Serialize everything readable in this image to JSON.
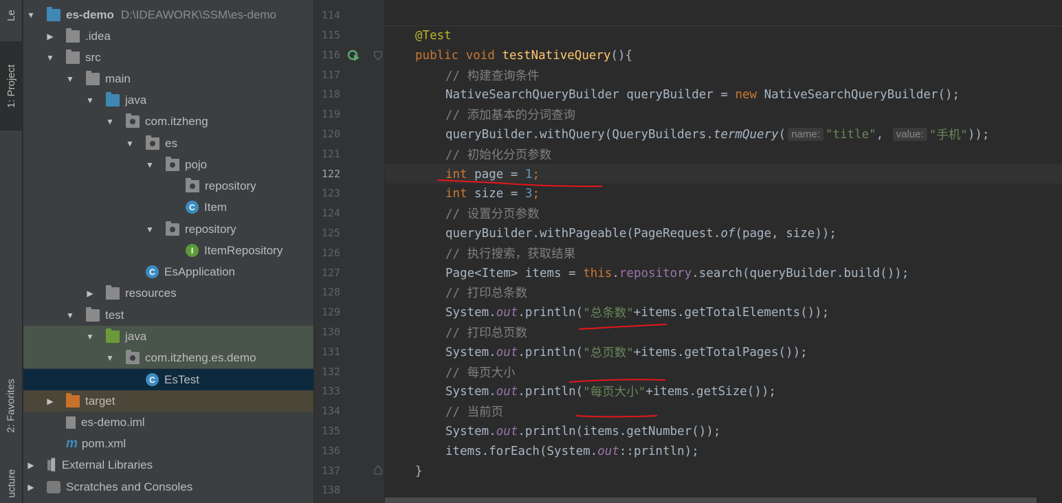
{
  "sidebar": {
    "tab_top": "Le",
    "tab_project": "1: Project",
    "tab_favorites": "2: Favorites",
    "tab_structure": "ucture"
  },
  "tree": [
    {
      "label": "es-demo",
      "path": "D:\\IDEAWORK\\SSM\\es-demo",
      "icon": "module-folder-icon"
    },
    {
      "label": ".idea",
      "icon": "folder-icon"
    },
    {
      "label": "src",
      "icon": "folder-icon"
    },
    {
      "label": "main",
      "icon": "folder-icon"
    },
    {
      "label": "java",
      "icon": "source-folder-icon"
    },
    {
      "label": "com.itzheng",
      "icon": "package-icon"
    },
    {
      "label": "es",
      "icon": "package-icon"
    },
    {
      "label": "pojo",
      "icon": "package-icon"
    },
    {
      "label": "repository",
      "icon": "package-icon"
    },
    {
      "label": "Item",
      "icon": "class-icon"
    },
    {
      "label": "repository",
      "icon": "package-icon"
    },
    {
      "label": "ItemRepository",
      "icon": "interface-icon"
    },
    {
      "label": "EsApplication",
      "icon": "spring-class-icon"
    },
    {
      "label": "resources",
      "icon": "resources-folder-icon"
    },
    {
      "label": "test",
      "icon": "folder-icon"
    },
    {
      "label": "java",
      "icon": "test-folder-icon"
    },
    {
      "label": "com.itzheng.es.demo",
      "icon": "package-icon"
    },
    {
      "label": "EsTest",
      "icon": "test-class-icon"
    },
    {
      "label": "target",
      "icon": "excluded-folder-icon"
    },
    {
      "label": "es-demo.iml",
      "icon": "iml-file-icon"
    },
    {
      "label": "pom.xml",
      "icon": "maven-icon"
    },
    {
      "label": "External Libraries",
      "icon": "libraries-icon"
    },
    {
      "label": "Scratches and Consoles",
      "icon": "scratches-icon"
    }
  ],
  "line_numbers": [
    "114",
    "115",
    "116",
    "117",
    "118",
    "119",
    "120",
    "121",
    "122",
    "123",
    "124",
    "125",
    "126",
    "127",
    "128",
    "129",
    "130",
    "131",
    "132",
    "133",
    "134",
    "135",
    "136",
    "137",
    "138"
  ],
  "code": {
    "l115": "@Test",
    "l116_kw": "public void ",
    "l116_fn": "testNativeQuery",
    "l116_end": "(){",
    "l117": "// 构建查询条件",
    "l118_a": "NativeSearchQueryBuilder queryBuilder = ",
    "l118_kw": "new",
    "l118_b": " NativeSearchQueryBuilder();",
    "l119": "// 添加基本的分词查询",
    "l120_a": "queryBuilder.withQuery(QueryBuilders.",
    "l120_it": "termQuery",
    "l120_b": "(",
    "l120_h1": "name:",
    "l120_s1": "\"title\"",
    "l120_c": ", ",
    "l120_h2": "value:",
    "l120_s2": "\"手机\"",
    "l120_d": "));",
    "l121": "// 初始化分页参数",
    "l122_kw": "int",
    "l122_a": " page = ",
    "l122_n": "1",
    "l122_b": ";",
    "l123_kw": "int",
    "l123_a": " size = ",
    "l123_n": "3",
    "l123_b": ";",
    "l124": "// 设置分页参数",
    "l125_a": "queryBuilder.withPageable(PageRequest.",
    "l125_it": "of",
    "l125_b": "(page, size));",
    "l126": "// 执行搜索，获取结果",
    "l127_a": "Page<Item> items = ",
    "l127_kw": "this",
    "l127_b": ".",
    "l127_f": "repository",
    "l127_c": ".search(queryBuilder.build());",
    "l128": "// 打印总条数",
    "l129_a": "System.",
    "l129_f": "out",
    "l129_b": ".println(",
    "l129_s": "\"总条数\"",
    "l129_c": "+items.getTotalElements());",
    "l130": "// 打印总页数",
    "l131_a": "System.",
    "l131_f": "out",
    "l131_b": ".println(",
    "l131_s": "\"总页数\"",
    "l131_c": "+items.getTotalPages());",
    "l132": "// 每页大小",
    "l133_a": "System.",
    "l133_f": "out",
    "l133_b": ".println(",
    "l133_s": "\"每页大小\"",
    "l133_c": "+items.getSize());",
    "l134": "// 当前页",
    "l135_a": "System.",
    "l135_f": "out",
    "l135_b": ".println(items.getNumber());",
    "l136_a": "items.forEach(System.",
    "l136_f": "out",
    "l136_b": "::println);",
    "l137": "}"
  },
  "colors": {
    "annotation_red": "#e8161b",
    "keyword": "#cc7832",
    "string": "#6a8759",
    "comment": "#808080"
  }
}
